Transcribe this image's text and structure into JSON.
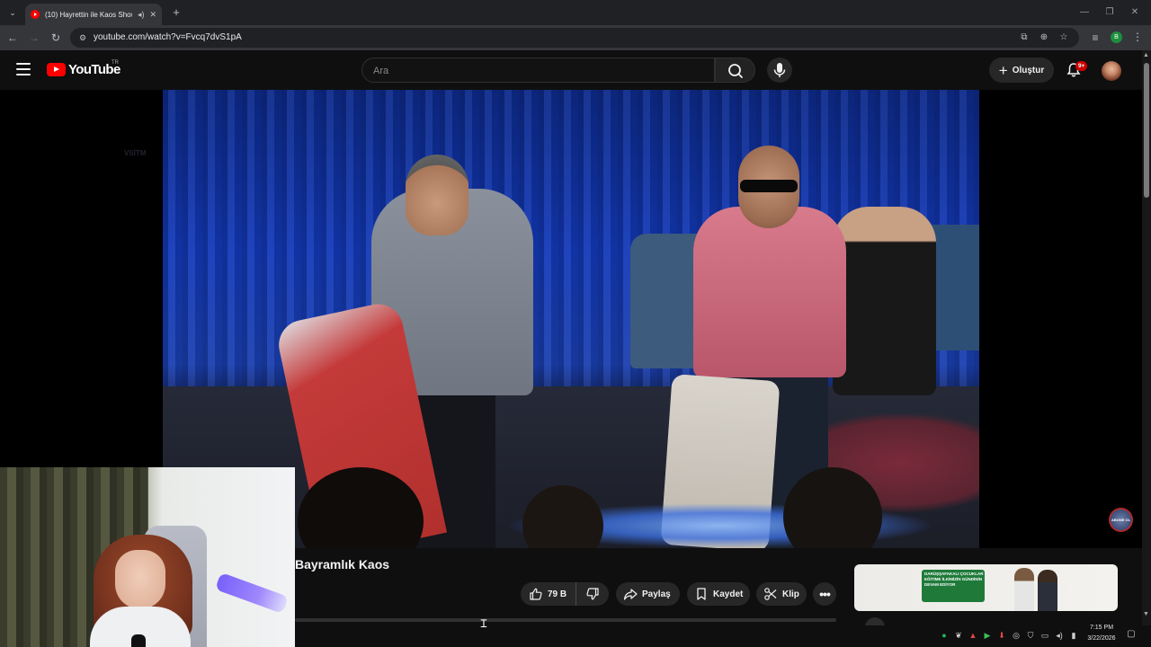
{
  "browser": {
    "tab": {
      "title": "(10) Hayrettin ile Kaos Show",
      "audio_icon": "speaker-icon",
      "close": "✕"
    },
    "new_tab": "+",
    "url": "youtube.com/watch?v=Fvcq7dvS1pA",
    "profile_initial": "B"
  },
  "youtube": {
    "logo_text": "YouTube",
    "country_code": "TR",
    "search_placeholder": "Ara",
    "create_label": "Oluştur",
    "notifications_badge": "9+",
    "accent_color": "#ff0000"
  },
  "video": {
    "title": "Bayramlık Kaos",
    "likes": "79 B",
    "share_label": "Paylaş",
    "save_label": "Kaydet",
    "clip_label": "Klip",
    "watermark": "ABONE OL"
  },
  "ad": {
    "headline": "DARÜŞŞAFAKALI ÇOCUKLAR EĞİTİME İLKİMİZİN GÜNDİNİN DEVAM EDİYOR"
  },
  "webcam": {
    "shirt_text": "VSİTM"
  },
  "system_tray": {
    "time": "7:15 PM",
    "date": "3/22/2026"
  }
}
